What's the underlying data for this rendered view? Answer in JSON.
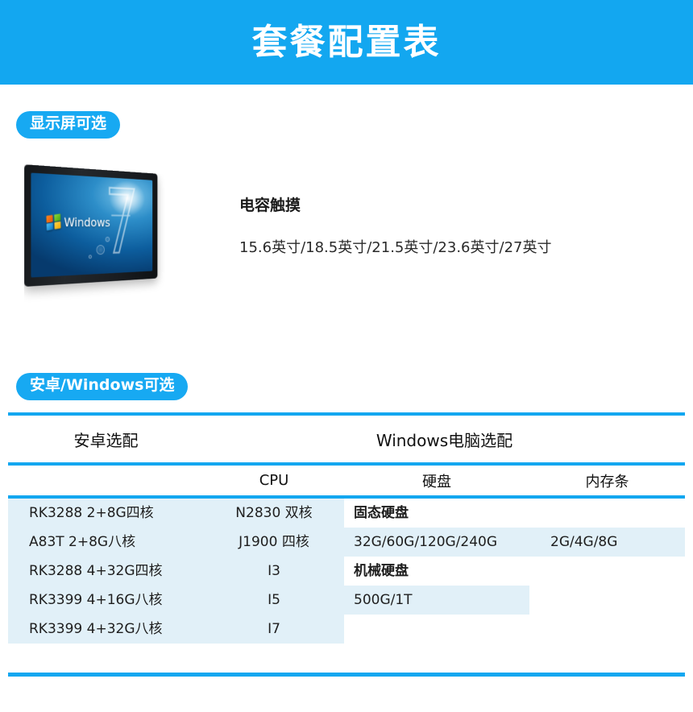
{
  "banner": {
    "title": "套餐配置表",
    "background": "#13a7f0"
  },
  "sections": {
    "display": {
      "badge": "显示屏可选",
      "product_image": "windows-7-touch-monitor",
      "screen_logo_text": "Windows",
      "heading": "电容触摸",
      "sizes": "15.6英寸/18.5英寸/21.5英寸/23.6英寸/27英寸"
    },
    "os": {
      "badge": "安卓/Windows可选"
    }
  },
  "spec_table": {
    "group_headers": {
      "android": "安卓选配",
      "windows": "Windows电脑选配"
    },
    "sub_headers": {
      "android": "",
      "cpu": "CPU",
      "disk": "硬盘",
      "ram": "内存条"
    },
    "columns": {
      "android": [
        "RK3288  2+8G四核",
        "A83T      2+8G八核",
        "RK3288  4+32G四核",
        "RK3399  4+16G八核",
        "RK3399  4+32G八核"
      ],
      "cpu": [
        "N2830  双核",
        "J1900   四核",
        "I3",
        "I5",
        "I7"
      ],
      "disk": [
        "固态硬盘",
        "32G/60G/120G/240G",
        "机械硬盘",
        "500G/1T",
        ""
      ],
      "ram": [
        "",
        "2G/4G/8G",
        "",
        "",
        ""
      ]
    }
  }
}
